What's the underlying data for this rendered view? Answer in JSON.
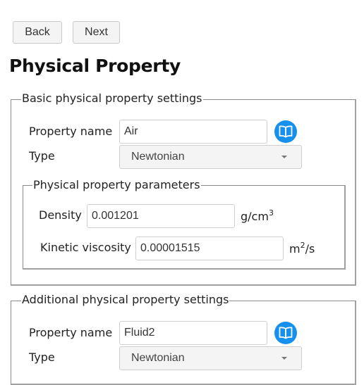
{
  "nav": {
    "back_label": "Back",
    "next_label": "Next"
  },
  "page_title": "Physical Property",
  "basic": {
    "legend": "Basic physical property settings",
    "property_name_label": "Property name",
    "property_name_value": "Air",
    "library_icon": "book-icon",
    "type_label": "Type",
    "type_value": "Newtonian",
    "parameters": {
      "legend": "Physical property parameters",
      "density_label": "Density",
      "density_value": "0.001201",
      "density_unit_base": "g/cm",
      "density_unit_exp": "3",
      "viscosity_label": "Kinetic viscosity",
      "viscosity_value": "0.00001515",
      "viscosity_unit_base": "m",
      "viscosity_unit_exp": "2",
      "viscosity_unit_tail": "/s"
    }
  },
  "additional": {
    "legend": "Additional physical property settings",
    "property_name_label": "Property name",
    "property_name_value": "Fluid2",
    "library_icon": "book-icon",
    "type_label": "Type",
    "type_value": "Newtonian"
  },
  "colors": {
    "accent": "#1590ec",
    "button_bg": "#f4f4f4",
    "fieldset_border": "#8a8a8a"
  }
}
